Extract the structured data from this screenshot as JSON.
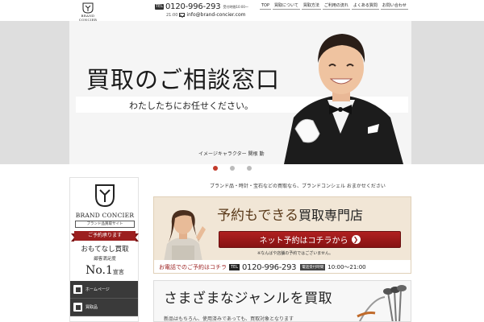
{
  "header": {
    "logo_text": "BRAND CONCIER",
    "tel_badge": "TEL",
    "phone": "0120-996-293",
    "phone_hours": "受付時間10:00〜",
    "mail_hours": "21:00",
    "email": "info@brand-concier.com",
    "nav": [
      "TOP",
      "買取について",
      "買取方法",
      "ご利用の流れ",
      "よくある質問",
      "お問い合わせ"
    ]
  },
  "hero": {
    "title": "買取のご相談窓口",
    "subtitle": "わたしたちにお任せください。",
    "caption": "イメージキャラクター 関根 勤",
    "dots": 3,
    "active_dot": 0
  },
  "sidebar": {
    "brand_name": "BRAND CONCIER",
    "brand_sub": "ブランド品買取サイト",
    "ribbon": "ご予約承ります",
    "omotenashi": "おもてなし買取",
    "satisfaction": "顧客満足度",
    "no1_big": "No.1",
    "no1_small": "宣言",
    "menu": [
      {
        "label": "ホームページ",
        "icon": "home-icon"
      },
      {
        "label": "買取品",
        "icon": "items-icon"
      }
    ]
  },
  "main": {
    "lead": "ブランド品・時計・宝石などの買取なら、ブランドコンシェル おまかせください",
    "banner": {
      "title_brown": "予約もできる",
      "title_dark": "買取専門店",
      "button_label": "ネット予約はコチラから",
      "note": "※なんばや店舗の予約ではございません。",
      "phone_label": "お電話でのご予約はコチラ",
      "tel_badge": "TEL",
      "phone": "0120-996-293",
      "hours_label": "電話受付時間",
      "hours": "10:00〜21:00"
    },
    "genre": {
      "title": "さまざまなジャンルを買取",
      "text": "新品はもちろん、使用済みであっても、買取対象となります"
    }
  },
  "colors": {
    "accent_red": "#9c1f1f",
    "dark_menu": "#3a3a3a",
    "banner_bg": "#f1e6d6"
  }
}
